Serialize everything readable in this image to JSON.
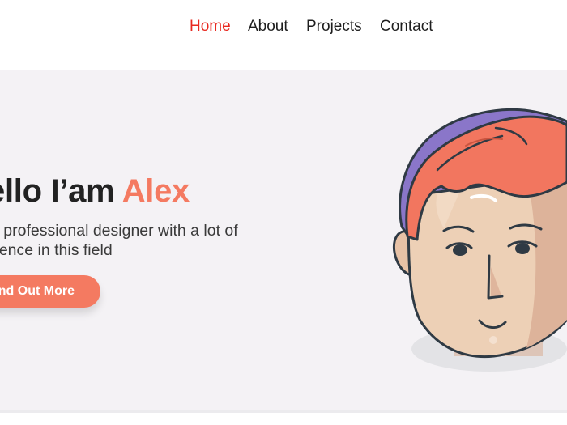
{
  "nav": {
    "items": [
      {
        "label": "Home",
        "active": true
      },
      {
        "label": "About",
        "active": false
      },
      {
        "label": "Projects",
        "active": false
      },
      {
        "label": "Contact",
        "active": false
      }
    ],
    "active_color": "#e8281f",
    "text_color": "#1e1e1e"
  },
  "hero": {
    "title_prefix": "ello I’am ",
    "title_name": "Alex",
    "text_line1": "a professional designer with a lot of",
    "text_line2": "rience in this field",
    "button_label": "nd Out More",
    "accent_color": "#f47a61",
    "background_color": "#f4f2f5",
    "illustration": "cartoon-avatar-illustration"
  }
}
